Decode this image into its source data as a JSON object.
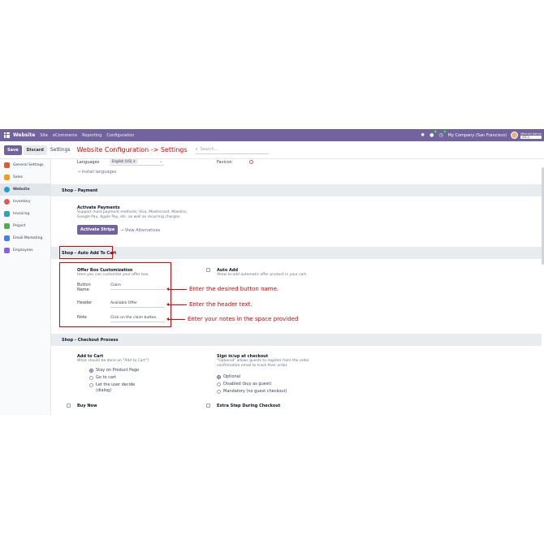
{
  "navbar": {
    "app_name": "Website",
    "menus": [
      "Site",
      "eCommerce",
      "Reporting",
      "Configuration"
    ],
    "chat_badge": "8",
    "activity_badge": "4",
    "company": "My Company (San Francisco)",
    "user_name": "Mitchell Admin",
    "database": "ATC2"
  },
  "control": {
    "save_label": "Save",
    "discard_label": "Discard",
    "title": "Settings",
    "annotation": "Website Configuration -> Settings",
    "search_placeholder": "Search..."
  },
  "sidebar": {
    "items": [
      {
        "label": "General Settings",
        "color": "#e4572e"
      },
      {
        "label": "Sales",
        "color": "#f59e0b"
      },
      {
        "label": "Website",
        "color": "#1ba2c7"
      },
      {
        "label": "Inventory",
        "color": "#e05a5a"
      },
      {
        "label": "Invoicing",
        "color": "#2aa3c9"
      },
      {
        "label": "Project",
        "color": "#4caf50"
      },
      {
        "label": "Email Marketing",
        "color": "#3b82f6"
      },
      {
        "label": "Employees",
        "color": "#8b5cf6"
      }
    ]
  },
  "website_top": {
    "languages_label": "Languages",
    "language_tag": "English (US)",
    "install_languages": "→ Install languages",
    "favicon_label": "Favicon"
  },
  "shop_payment": {
    "title": "Shop - Payment",
    "activate_label": "Activate Payments",
    "activate_help_1": "Support most payment methods; Visa, Mastercard, Maestro,",
    "activate_help_2": "Google Pay, Apple Pay, etc. as well as recurring charges.",
    "stripe_button": "Activate Stripe",
    "alternatives_link": "→ View Alternatives"
  },
  "auto_add": {
    "title": "Shop - Auto Add To Cart",
    "offer_label": "Offer Box Customization",
    "offer_help": "Here you can customize your offer box.",
    "fields": [
      {
        "label_1": "Button",
        "label_2": "Name",
        "value": "Claim"
      },
      {
        "label_1": "Header",
        "label_2": "",
        "value": "Available Offer"
      },
      {
        "label_1": "Note",
        "label_2": "",
        "value": "Click on the claim button."
      }
    ],
    "auto_add_label": "Auto Add",
    "auto_add_help": "Allow to add automatic offer product in your cart.",
    "annotations": [
      "Enter the desired button name.",
      "Enter the header text.",
      "Enter your notes in the space provided"
    ]
  },
  "checkout": {
    "title": "Shop - Checkout Process",
    "add_to_cart_label": "Add to Cart",
    "add_to_cart_help": "What should be done on \"Add to Cart\"?",
    "add_to_cart_options": [
      "Stay on Product Page",
      "Go to cart",
      "Let the user decide",
      "(dialog)"
    ],
    "signin_label": "Sign in/up at checkout",
    "signin_help_1": "\"Optional\" allows guests to register from the order",
    "signin_help_2": "confirmation email to track their order.",
    "signin_options": [
      "Optional",
      "Disabled (buy as guest)",
      "Mandatory (no guest checkout)"
    ],
    "buy_now_label": "Buy Now",
    "extra_step_label": "Extra Step During Checkout"
  }
}
